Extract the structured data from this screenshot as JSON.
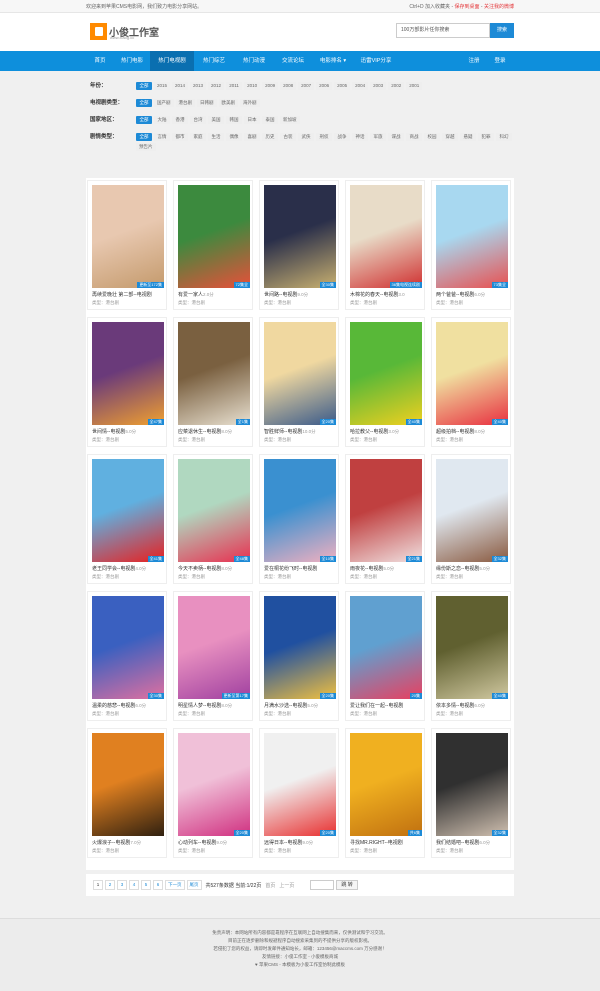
{
  "topbar": {
    "welcome": "欢迎来到苹果CMS电影网，我们致力电影分享网站。",
    "shortcut": "Ctrl+D 加入收藏夹",
    "save_desktop": "保存到桌面",
    "follow_weibo": "关注我的微博"
  },
  "logo": {
    "title": "小俊工作室",
    "subtitle": "www.xiaog.cc"
  },
  "search": {
    "placeholder": "100万部影片任你搜索",
    "button": "搜索"
  },
  "nav": {
    "items": [
      "首页",
      "热门电影",
      "热门电视剧",
      "热门综艺",
      "热门动漫",
      "交流论坛",
      "电影排名 ▾",
      "迅雷VIP分享"
    ],
    "register": "注册",
    "login": "登录"
  },
  "filters": [
    {
      "label": "年份：",
      "tags": [
        "全部",
        "2015",
        "2014",
        "2013",
        "2012",
        "2011",
        "2010",
        "2009",
        "2008",
        "2007",
        "2006",
        "2005",
        "2004",
        "2003",
        "2002",
        "2001"
      ]
    },
    {
      "label": "电视剧类型：",
      "tags": [
        "全部",
        "国产剧",
        "港台剧",
        "日韩剧",
        "欧美剧",
        "海外剧"
      ]
    },
    {
      "label": "国家地区：",
      "tags": [
        "全部",
        "大陆",
        "香港",
        "台湾",
        "美国",
        "韩国",
        "日本",
        "泰国",
        "新加坡"
      ]
    },
    {
      "label": "剧情类型：",
      "tags": [
        "全部",
        "言情",
        "都市",
        "家庭",
        "生活",
        "偶像",
        "喜剧",
        "历史",
        "古装",
        "武侠",
        "刑侦",
        "战争",
        "神话",
        "军旅",
        "谍战",
        "商战",
        "校园",
        "穿越",
        "悬疑",
        "犯罪",
        "科幻",
        "预告片"
      ]
    }
  ],
  "items": [
    {
      "title": "再续爱晚壮 第二部--电视剧",
      "score": "",
      "type": "类型：港台剧",
      "badge": "更新至172集",
      "color": "#e8c8b0",
      "color2": "#c49a6c"
    },
    {
      "title": "有爱一家人",
      "score": "2.0分",
      "type": "类型：港台剧",
      "badge": "72集全",
      "color": "#3c8a3e",
      "color2": "#e8503a"
    },
    {
      "title": "世间路--电视剧",
      "score": "9.0分",
      "type": "类型：港台剧",
      "badge": "全30集",
      "color": "#2a2f4a",
      "color2": "#c8b070"
    },
    {
      "title": "木棉花的春天--电视剧",
      "score": "3.0",
      "type": "类型：港台剧",
      "badge": "36集电视连续剧",
      "color": "#e8dcc8",
      "color2": "#d03030"
    },
    {
      "title": "两个爸爸--电视剧",
      "score": "6.0分",
      "type": "类型：港台剧",
      "badge": "73集全",
      "color": "#a8d8f0",
      "color2": "#e85050"
    },
    {
      "title": "世间情--电视剧",
      "score": "5.0分",
      "type": "类型：港台剧",
      "badge": "全47集",
      "color": "#6a3a7a",
      "color2": "#f0a030"
    },
    {
      "title": "应菜退休生--电视剧",
      "score": "8.0分",
      "type": "类型：港台剧",
      "badge": "全1集",
      "color": "#7a6040",
      "color2": "#e8e0d0"
    },
    {
      "title": "智胜鲜师--电视剧",
      "score": "10.0分",
      "type": "类型：港台剧",
      "badge": "全20集",
      "color": "#f0d8a0",
      "color2": "#3a5a8a"
    },
    {
      "title": "哈拉教父--电视剧",
      "score": "3.0分",
      "type": "类型：港台剧",
      "badge": "全40集",
      "color": "#58b838",
      "color2": "#f0d020"
    },
    {
      "title": "超级拍档--电视剧",
      "score": "8.0分",
      "type": "类型：港台剧",
      "badge": "全40集",
      "color": "#f0e0a0",
      "color2": "#e83040"
    },
    {
      "title": "老王同学会--电视剧",
      "score": "4.0分",
      "type": "类型：港台剧",
      "badge": "全41集",
      "color": "#60b0e0",
      "color2": "#e82020"
    },
    {
      "title": "今天不卖柄--电视剧",
      "score": "8.0分",
      "type": "类型：港台剧",
      "badge": "全48集",
      "color": "#b0d8c0",
      "color2": "#e83050"
    },
    {
      "title": "爱在桐花纷飞时--电视剧",
      "score": "",
      "type": "类型：港台剧",
      "badge": "全10集",
      "color": "#3a90d0",
      "color2": "#f0b0c0"
    },
    {
      "title": "雨夜花--电视剧",
      "score": "5.0分",
      "type": "类型：港台剧",
      "badge": "全21集",
      "color": "#c04040",
      "color2": "#f0e0e0"
    },
    {
      "title": "缘份斯之恋--电视剧",
      "score": "5.0分",
      "type": "类型：港台剧",
      "badge": "全32集",
      "color": "#e0e8f0",
      "color2": "#8a5a40"
    },
    {
      "title": "温柔的慈悲--电视剧",
      "score": "6.0分",
      "type": "类型：港台剧",
      "badge": "全30集",
      "color": "#3a60c0",
      "color2": "#e070a0"
    },
    {
      "title": "明星情人梦--电视剧",
      "score": "8.0分",
      "type": "类型：港台剧",
      "badge": "更新至第17集",
      "color": "#e890c0",
      "color2": "#a040a0"
    },
    {
      "title": "月满水沙选--电视剧",
      "score": "5.0分",
      "type": "类型：港台剧",
      "badge": "全20集",
      "color": "#2050a0",
      "color2": "#f0c040"
    },
    {
      "title": "爱让我们在一起--电视剧",
      "score": "",
      "type": "类型：港台剧",
      "badge": "20集",
      "color": "#60a0d0",
      "color2": "#e84060"
    },
    {
      "title": "依本多情--电视剧",
      "score": "6.0分",
      "type": "类型：港台剧",
      "badge": "全40集",
      "color": "#606030",
      "color2": "#d0c8a0"
    },
    {
      "title": "火爆浪子--电视剧",
      "score": "7.0分",
      "type": "类型：港台剧",
      "badge": "",
      "color": "#e08020",
      "color2": "#302010"
    },
    {
      "title": "心动列车--电视剧",
      "score": "9.0分",
      "type": "类型：港台剧",
      "badge": "全20集",
      "color": "#f0c0d8",
      "color2": "#d03080"
    },
    {
      "title": "远得日本--电视剧",
      "score": "9.0分",
      "type": "类型：港台剧",
      "badge": "全20集",
      "color": "#f0f0f0",
      "color2": "#e83030"
    },
    {
      "title": "寻找MR.RIGHT--电视剧",
      "score": "",
      "type": "类型：港台剧",
      "badge": "共6集",
      "color": "#f0b020",
      "color2": "#c07010"
    },
    {
      "title": "我们结婚吧--电视剧",
      "score": "6.0分",
      "type": "类型：港台剧",
      "badge": "全32集",
      "color": "#303030",
      "color2": "#d0c0b0"
    }
  ],
  "pager": {
    "pages": [
      "1",
      "2",
      "3",
      "4",
      "5",
      "6",
      "下一页",
      "尾页"
    ],
    "total": "共527条数据 当前:1/22页",
    "first": "首页",
    "prev": "上一页",
    "go": "跳 转"
  },
  "footer": {
    "line1": "免责声明：本网站所有内容都是靠程序在互联网上自动搜集而来，仅供测试和学习交流。",
    "line2": "目前正在逐步删除和规避程序自动搜索采集到的不提供分享的版权影视。",
    "line3": "若侵犯了您的权益，请即时发邮件通知站长，邮箱：123456@maccms.com 万分感谢！",
    "line4": "友情链接：小俊工作室 - 小俊模板商城",
    "line5": "♥ 苹果CMS - 本模板为小俊工作室仿制此模板"
  }
}
